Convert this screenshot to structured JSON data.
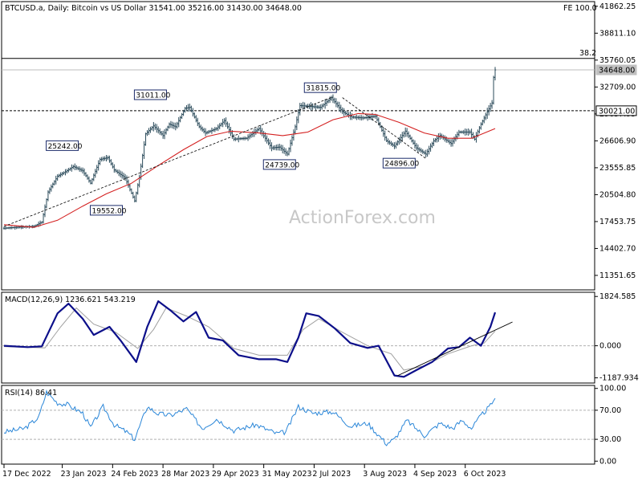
{
  "chart_data": [
    {
      "type": "candlestick",
      "header": "BTCUSD.a, Daily:  Bitcoin vs US Dollar  31541.00 35216.00 31430.00 34648.00",
      "fe_label": "FE 100.0",
      "fib_label": "38.2",
      "watermark": "ActionForex.com",
      "ylim": [
        9800,
        42300
      ],
      "y_ticks": [
        41862.25,
        38811.1,
        35760.05,
        32709.0,
        29657.95,
        26606.9,
        23555.85,
        20504.8,
        17453.75,
        14402.7,
        11351.65
      ],
      "y_tick_labels": [
        "41862.25",
        "38811.10",
        "35760.05",
        "32709.00",
        "29657.95",
        "26606.90",
        "23555.85",
        "20504.80",
        "17453.75",
        "14402.70",
        "11351.65"
      ],
      "level_lines": [
        {
          "value": 35950,
          "label": ""
        },
        {
          "value": 34648,
          "label": "34648.00"
        },
        {
          "value": 30021,
          "label": "30021.00"
        }
      ],
      "x_dates": [
        "17 Dec 2022",
        "23 Jan 2023",
        "24 Feb 2023",
        "28 Mar 2023",
        "29 Apr 2023",
        "31 May 2023",
        "2 Jul 2023",
        "3 Aug 2023",
        "4 Sep 2023",
        "6 Oct 2023"
      ],
      "close_path": [
        [
          "2022-12-17",
          16700
        ],
        [
          "2022-12-25",
          16800
        ],
        [
          "2023-01-05",
          16900
        ],
        [
          "2023-01-10",
          17400
        ],
        [
          "2023-01-14",
          20800
        ],
        [
          "2023-01-20",
          22600
        ],
        [
          "2023-01-25",
          23100
        ],
        [
          "2023-01-30",
          23700
        ],
        [
          "2023-02-05",
          23200
        ],
        [
          "2023-02-10",
          21800
        ],
        [
          "2023-02-16",
          24500
        ],
        [
          "2023-02-21",
          24700
        ],
        [
          "2023-02-25",
          23300
        ],
        [
          "2023-03-04",
          22400
        ],
        [
          "2023-03-10",
          19800
        ],
        [
          "2023-03-13",
          22500
        ],
        [
          "2023-03-17",
          27400
        ],
        [
          "2023-03-22",
          28300
        ],
        [
          "2023-03-28",
          27200
        ],
        [
          "2023-04-01",
          28500
        ],
        [
          "2023-04-05",
          28200
        ],
        [
          "2023-04-11",
          30300
        ],
        [
          "2023-04-14",
          30400
        ],
        [
          "2023-04-20",
          28200
        ],
        [
          "2023-04-24",
          27500
        ],
        [
          "2023-05-01",
          28000
        ],
        [
          "2023-05-06",
          28900
        ],
        [
          "2023-05-12",
          26800
        ],
        [
          "2023-05-20",
          26900
        ],
        [
          "2023-05-28",
          28000
        ],
        [
          "2023-06-05",
          25800
        ],
        [
          "2023-06-10",
          25900
        ],
        [
          "2023-06-15",
          25100
        ],
        [
          "2023-06-20",
          28200
        ],
        [
          "2023-06-23",
          30600
        ],
        [
          "2023-06-30",
          30500
        ],
        [
          "2023-07-06",
          30400
        ],
        [
          "2023-07-13",
          31500
        ],
        [
          "2023-07-20",
          29900
        ],
        [
          "2023-07-26",
          29300
        ],
        [
          "2023-08-02",
          29200
        ],
        [
          "2023-08-10",
          29400
        ],
        [
          "2023-08-17",
          26600
        ],
        [
          "2023-08-22",
          26000
        ],
        [
          "2023-08-29",
          27700
        ],
        [
          "2023-09-05",
          25800
        ],
        [
          "2023-09-11",
          25100
        ],
        [
          "2023-09-16",
          26600
        ],
        [
          "2023-09-20",
          27200
        ],
        [
          "2023-09-27",
          26300
        ],
        [
          "2023-10-02",
          27600
        ],
        [
          "2023-10-09",
          27600
        ],
        [
          "2023-10-12",
          26800
        ],
        [
          "2023-10-16",
          28500
        ],
        [
          "2023-10-20",
          29900
        ],
        [
          "2023-10-23",
          30900
        ],
        [
          "2023-10-24",
          33800
        ],
        [
          "2023-10-25",
          34648
        ]
      ],
      "ma_path": [
        [
          "2022-12-17",
          17100
        ],
        [
          "2023-01-05",
          16800
        ],
        [
          "2023-01-20",
          17600
        ],
        [
          "2023-02-05",
          19200
        ],
        [
          "2023-02-20",
          20600
        ],
        [
          "2023-03-08",
          21800
        ],
        [
          "2023-03-24",
          23700
        ],
        [
          "2023-04-10",
          25600
        ],
        [
          "2023-04-25",
          27100
        ],
        [
          "2023-05-10",
          27700
        ],
        [
          "2023-05-28",
          27500
        ],
        [
          "2023-06-12",
          27200
        ],
        [
          "2023-06-28",
          27600
        ],
        [
          "2023-07-14",
          29000
        ],
        [
          "2023-07-30",
          29700
        ],
        [
          "2023-08-10",
          29600
        ],
        [
          "2023-08-25",
          28700
        ],
        [
          "2023-09-10",
          27500
        ],
        [
          "2023-09-25",
          26900
        ],
        [
          "2023-10-10",
          26900
        ],
        [
          "2023-10-25",
          28000
        ]
      ],
      "trendline": [
        [
          "2022-12-17",
          16900
        ],
        [
          "2023-07-14",
          31600
        ]
      ],
      "trendline2": [
        [
          "2023-07-20",
          31500
        ],
        [
          "2023-09-11",
          24600
        ]
      ],
      "price_labels": [
        {
          "date": "2023-03-20",
          "value": 31011,
          "text": "31011.00",
          "pos": "above"
        },
        {
          "date": "2023-01-23",
          "value": 25242,
          "text": "25242.00",
          "pos": "above"
        },
        {
          "date": "2023-02-20",
          "value": 19552,
          "text": "19552.00",
          "pos": "below"
        },
        {
          "date": "2023-06-10",
          "value": 24739,
          "text": "24739.00",
          "pos": "below"
        },
        {
          "date": "2023-07-06",
          "value": 31815,
          "text": "31815.00",
          "pos": "above"
        },
        {
          "date": "2023-08-25",
          "value": 24896,
          "text": "24896.00",
          "pos": "below"
        }
      ]
    },
    {
      "type": "line",
      "header": "MACD(12,26,9) 1236.621 543.219",
      "ylim": [
        -1350,
        1950
      ],
      "y_ticks": [
        1824.585,
        0,
        -1187.934
      ],
      "y_tick_labels": [
        "1824.585",
        "0.000",
        "-1187.934"
      ],
      "macd_path": [
        [
          "2022-12-17",
          0
        ],
        [
          "2023-01-01",
          -50
        ],
        [
          "2023-01-10",
          -20
        ],
        [
          "2023-01-20",
          1200
        ],
        [
          "2023-01-27",
          1560
        ],
        [
          "2023-02-05",
          1000
        ],
        [
          "2023-02-12",
          400
        ],
        [
          "2023-02-22",
          700
        ],
        [
          "2023-03-01",
          200
        ],
        [
          "2023-03-11",
          -600
        ],
        [
          "2023-03-18",
          700
        ],
        [
          "2023-03-25",
          1650
        ],
        [
          "2023-04-02",
          1300
        ],
        [
          "2023-04-10",
          900
        ],
        [
          "2023-04-18",
          1250
        ],
        [
          "2023-04-26",
          300
        ],
        [
          "2023-05-05",
          200
        ],
        [
          "2023-05-15",
          -350
        ],
        [
          "2023-05-28",
          -500
        ],
        [
          "2023-06-08",
          -500
        ],
        [
          "2023-06-15",
          -600
        ],
        [
          "2023-06-22",
          300
        ],
        [
          "2023-06-27",
          1200
        ],
        [
          "2023-07-05",
          1100
        ],
        [
          "2023-07-15",
          650
        ],
        [
          "2023-07-25",
          100
        ],
        [
          "2023-08-05",
          -80
        ],
        [
          "2023-08-12",
          0
        ],
        [
          "2023-08-22",
          -1100
        ],
        [
          "2023-08-28",
          -1150
        ],
        [
          "2023-09-05",
          -900
        ],
        [
          "2023-09-15",
          -600
        ],
        [
          "2023-09-25",
          -100
        ],
        [
          "2023-10-02",
          -50
        ],
        [
          "2023-10-09",
          300
        ],
        [
          "2023-10-16",
          0
        ],
        [
          "2023-10-22",
          700
        ],
        [
          "2023-10-25",
          1236
        ]
      ],
      "signal_path": [
        [
          "2022-12-17",
          -30
        ],
        [
          "2023-01-12",
          -80
        ],
        [
          "2023-01-22",
          700
        ],
        [
          "2023-02-01",
          1400
        ],
        [
          "2023-02-12",
          800
        ],
        [
          "2023-02-26",
          500
        ],
        [
          "2023-03-12",
          -100
        ],
        [
          "2023-03-22",
          600
        ],
        [
          "2023-03-30",
          1400
        ],
        [
          "2023-04-12",
          1100
        ],
        [
          "2023-04-26",
          700
        ],
        [
          "2023-05-12",
          -100
        ],
        [
          "2023-05-28",
          -350
        ],
        [
          "2023-06-15",
          -350
        ],
        [
          "2023-06-25",
          600
        ],
        [
          "2023-07-05",
          1000
        ],
        [
          "2023-07-20",
          500
        ],
        [
          "2023-08-05",
          0
        ],
        [
          "2023-08-20",
          -300
        ],
        [
          "2023-08-28",
          -900
        ],
        [
          "2023-09-10",
          -750
        ],
        [
          "2023-09-25",
          -300
        ],
        [
          "2023-10-10",
          0
        ],
        [
          "2023-10-18",
          100
        ],
        [
          "2023-10-25",
          543
        ]
      ],
      "trendline": [
        [
          "2023-08-24",
          -1110
        ],
        [
          "2023-11-05",
          880
        ]
      ]
    },
    {
      "type": "line",
      "header": "RSI(14) 86.41",
      "ylim": [
        -3,
        103
      ],
      "y_ticks": [
        100,
        70,
        30,
        0
      ],
      "y_tick_labels": [
        "100.00",
        "70.00",
        "30.00",
        "0.00"
      ],
      "guides": [
        70,
        30
      ],
      "rsi_path": [
        [
          "2022-12-17",
          40
        ],
        [
          "2022-12-30",
          45
        ],
        [
          "2023-01-08",
          60
        ],
        [
          "2023-01-13",
          95
        ],
        [
          "2023-01-20",
          80
        ],
        [
          "2023-01-26",
          78
        ],
        [
          "2023-02-05",
          66
        ],
        [
          "2023-02-10",
          46
        ],
        [
          "2023-02-18",
          75
        ],
        [
          "2023-02-25",
          50
        ],
        [
          "2023-03-05",
          40
        ],
        [
          "2023-03-10",
          30
        ],
        [
          "2023-03-18",
          75
        ],
        [
          "2023-03-25",
          65
        ],
        [
          "2023-04-02",
          63
        ],
        [
          "2023-04-12",
          72
        ],
        [
          "2023-04-22",
          45
        ],
        [
          "2023-05-01",
          58
        ],
        [
          "2023-05-12",
          42
        ],
        [
          "2023-05-26",
          50
        ],
        [
          "2023-06-08",
          38
        ],
        [
          "2023-06-14",
          40
        ],
        [
          "2023-06-22",
          75
        ],
        [
          "2023-07-01",
          66
        ],
        [
          "2023-07-14",
          68
        ],
        [
          "2023-07-25",
          48
        ],
        [
          "2023-08-05",
          52
        ],
        [
          "2023-08-17",
          24
        ],
        [
          "2023-08-22",
          30
        ],
        [
          "2023-08-30",
          56
        ],
        [
          "2023-09-10",
          35
        ],
        [
          "2023-09-20",
          52
        ],
        [
          "2023-09-28",
          45
        ],
        [
          "2023-10-04",
          56
        ],
        [
          "2023-10-10",
          45
        ],
        [
          "2023-10-17",
          65
        ],
        [
          "2023-10-22",
          76
        ],
        [
          "2023-10-25",
          86.41
        ]
      ]
    }
  ]
}
